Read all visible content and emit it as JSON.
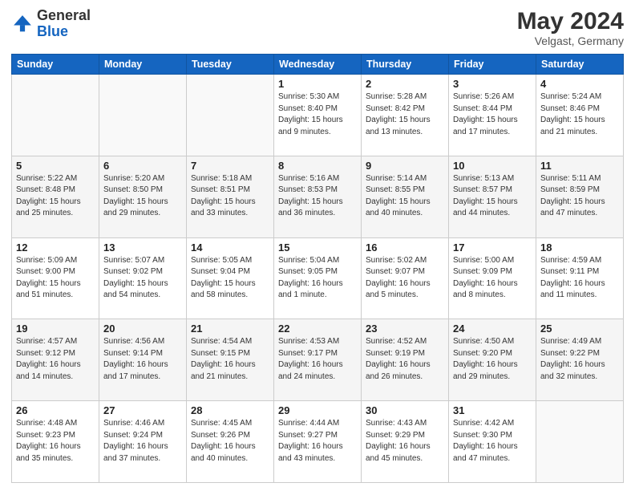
{
  "header": {
    "logo_general": "General",
    "logo_blue": "Blue",
    "month_title": "May 2024",
    "location": "Velgast, Germany"
  },
  "columns": [
    "Sunday",
    "Monday",
    "Tuesday",
    "Wednesday",
    "Thursday",
    "Friday",
    "Saturday"
  ],
  "weeks": [
    [
      {
        "day": "",
        "empty": true
      },
      {
        "day": "",
        "empty": true
      },
      {
        "day": "",
        "empty": true
      },
      {
        "day": "1",
        "sunrise": "5:30 AM",
        "sunset": "8:40 PM",
        "daylight": "15 hours and 9 minutes."
      },
      {
        "day": "2",
        "sunrise": "5:28 AM",
        "sunset": "8:42 PM",
        "daylight": "15 hours and 13 minutes."
      },
      {
        "day": "3",
        "sunrise": "5:26 AM",
        "sunset": "8:44 PM",
        "daylight": "15 hours and 17 minutes."
      },
      {
        "day": "4",
        "sunrise": "5:24 AM",
        "sunset": "8:46 PM",
        "daylight": "15 hours and 21 minutes."
      }
    ],
    [
      {
        "day": "5",
        "sunrise": "5:22 AM",
        "sunset": "8:48 PM",
        "daylight": "15 hours and 25 minutes."
      },
      {
        "day": "6",
        "sunrise": "5:20 AM",
        "sunset": "8:50 PM",
        "daylight": "15 hours and 29 minutes."
      },
      {
        "day": "7",
        "sunrise": "5:18 AM",
        "sunset": "8:51 PM",
        "daylight": "15 hours and 33 minutes."
      },
      {
        "day": "8",
        "sunrise": "5:16 AM",
        "sunset": "8:53 PM",
        "daylight": "15 hours and 36 minutes."
      },
      {
        "day": "9",
        "sunrise": "5:14 AM",
        "sunset": "8:55 PM",
        "daylight": "15 hours and 40 minutes."
      },
      {
        "day": "10",
        "sunrise": "5:13 AM",
        "sunset": "8:57 PM",
        "daylight": "15 hours and 44 minutes."
      },
      {
        "day": "11",
        "sunrise": "5:11 AM",
        "sunset": "8:59 PM",
        "daylight": "15 hours and 47 minutes."
      }
    ],
    [
      {
        "day": "12",
        "sunrise": "5:09 AM",
        "sunset": "9:00 PM",
        "daylight": "15 hours and 51 minutes."
      },
      {
        "day": "13",
        "sunrise": "5:07 AM",
        "sunset": "9:02 PM",
        "daylight": "15 hours and 54 minutes."
      },
      {
        "day": "14",
        "sunrise": "5:05 AM",
        "sunset": "9:04 PM",
        "daylight": "15 hours and 58 minutes."
      },
      {
        "day": "15",
        "sunrise": "5:04 AM",
        "sunset": "9:05 PM",
        "daylight": "16 hours and 1 minute."
      },
      {
        "day": "16",
        "sunrise": "5:02 AM",
        "sunset": "9:07 PM",
        "daylight": "16 hours and 5 minutes."
      },
      {
        "day": "17",
        "sunrise": "5:00 AM",
        "sunset": "9:09 PM",
        "daylight": "16 hours and 8 minutes."
      },
      {
        "day": "18",
        "sunrise": "4:59 AM",
        "sunset": "9:11 PM",
        "daylight": "16 hours and 11 minutes."
      }
    ],
    [
      {
        "day": "19",
        "sunrise": "4:57 AM",
        "sunset": "9:12 PM",
        "daylight": "16 hours and 14 minutes."
      },
      {
        "day": "20",
        "sunrise": "4:56 AM",
        "sunset": "9:14 PM",
        "daylight": "16 hours and 17 minutes."
      },
      {
        "day": "21",
        "sunrise": "4:54 AM",
        "sunset": "9:15 PM",
        "daylight": "16 hours and 21 minutes."
      },
      {
        "day": "22",
        "sunrise": "4:53 AM",
        "sunset": "9:17 PM",
        "daylight": "16 hours and 24 minutes."
      },
      {
        "day": "23",
        "sunrise": "4:52 AM",
        "sunset": "9:19 PM",
        "daylight": "16 hours and 26 minutes."
      },
      {
        "day": "24",
        "sunrise": "4:50 AM",
        "sunset": "9:20 PM",
        "daylight": "16 hours and 29 minutes."
      },
      {
        "day": "25",
        "sunrise": "4:49 AM",
        "sunset": "9:22 PM",
        "daylight": "16 hours and 32 minutes."
      }
    ],
    [
      {
        "day": "26",
        "sunrise": "4:48 AM",
        "sunset": "9:23 PM",
        "daylight": "16 hours and 35 minutes."
      },
      {
        "day": "27",
        "sunrise": "4:46 AM",
        "sunset": "9:24 PM",
        "daylight": "16 hours and 37 minutes."
      },
      {
        "day": "28",
        "sunrise": "4:45 AM",
        "sunset": "9:26 PM",
        "daylight": "16 hours and 40 minutes."
      },
      {
        "day": "29",
        "sunrise": "4:44 AM",
        "sunset": "9:27 PM",
        "daylight": "16 hours and 43 minutes."
      },
      {
        "day": "30",
        "sunrise": "4:43 AM",
        "sunset": "9:29 PM",
        "daylight": "16 hours and 45 minutes."
      },
      {
        "day": "31",
        "sunrise": "4:42 AM",
        "sunset": "9:30 PM",
        "daylight": "16 hours and 47 minutes."
      },
      {
        "day": "",
        "empty": true
      }
    ]
  ]
}
